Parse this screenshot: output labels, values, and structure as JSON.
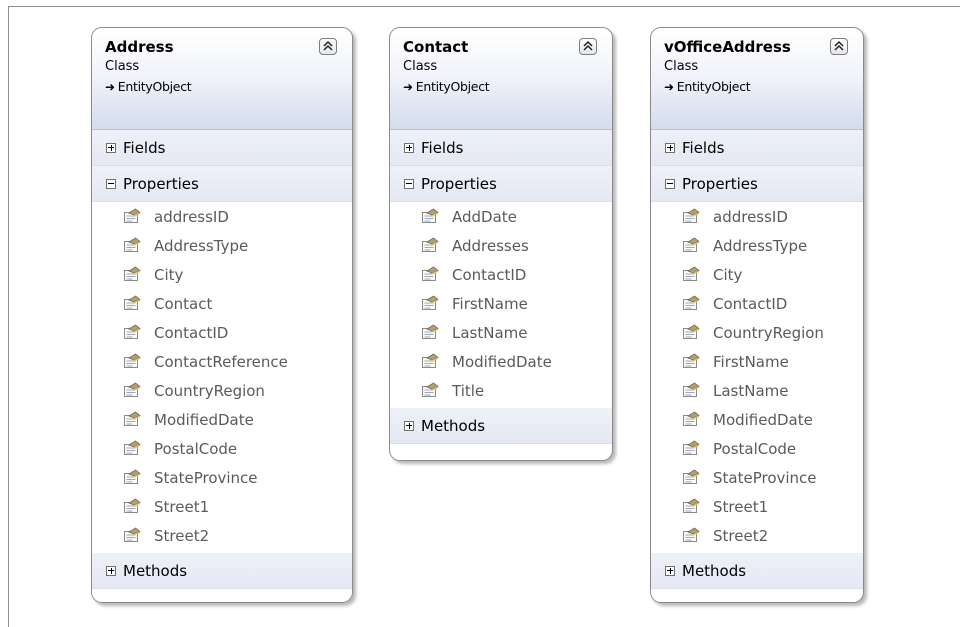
{
  "classes": [
    {
      "name": "Address",
      "kind": "Class",
      "base": "EntityObject",
      "fields_label": "Fields",
      "properties_label": "Properties",
      "methods_label": "Methods",
      "properties": [
        "addressID",
        "AddressType",
        "City",
        "Contact",
        "ContactID",
        "ContactReference",
        "CountryRegion",
        "ModifiedDate",
        "PostalCode",
        "StateProvince",
        "Street1",
        "Street2"
      ]
    },
    {
      "name": "Contact",
      "kind": "Class",
      "base": "EntityObject",
      "fields_label": "Fields",
      "properties_label": "Properties",
      "methods_label": "Methods",
      "properties": [
        "AddDate",
        "Addresses",
        "ContactID",
        "FirstName",
        "LastName",
        "ModifiedDate",
        "Title"
      ]
    },
    {
      "name": "vOfficeAddress",
      "kind": "Class",
      "base": "EntityObject",
      "fields_label": "Fields",
      "properties_label": "Properties",
      "methods_label": "Methods",
      "properties": [
        "addressID",
        "AddressType",
        "City",
        "ContactID",
        "CountryRegion",
        "FirstName",
        "LastName",
        "ModifiedDate",
        "PostalCode",
        "StateProvince",
        "Street1",
        "Street2"
      ]
    }
  ]
}
